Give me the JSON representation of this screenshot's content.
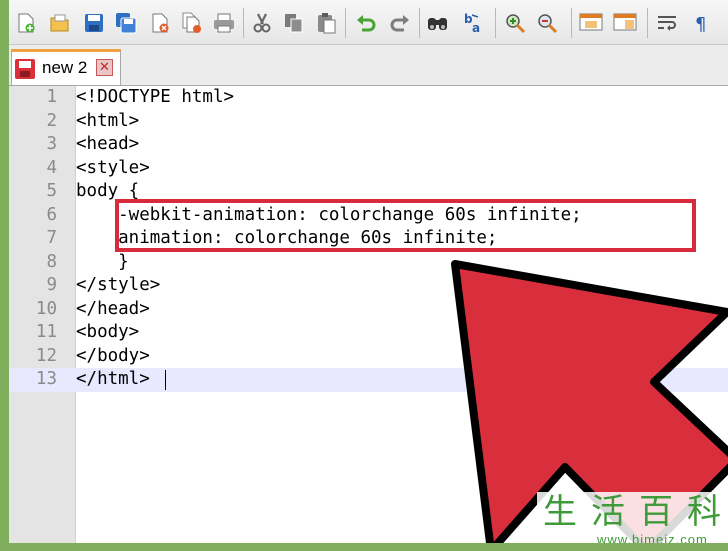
{
  "tabs": [
    {
      "label": "new 2",
      "close_symbol": "✕"
    }
  ],
  "toolbar": {
    "buttons": [
      "new-file-icon",
      "open-file-icon",
      "save-icon",
      "save-all-icon",
      "close-icon",
      "close-all-icon",
      "print-icon",
      "cut-icon",
      "copy-icon",
      "paste-icon",
      "undo-icon",
      "redo-icon",
      "find-icon",
      "replace-icon",
      "zoom-in-icon",
      "zoom-out-icon",
      "sync-vertical-icon",
      "sync-horizontal-icon",
      "word-wrap-icon",
      "show-all-characters-icon"
    ]
  },
  "editor": {
    "lines": [
      {
        "n": "1",
        "text": "<!DOCTYPE html>"
      },
      {
        "n": "2",
        "text": "<html>"
      },
      {
        "n": "3",
        "text": "<head>"
      },
      {
        "n": "4",
        "text": "<style>"
      },
      {
        "n": "5",
        "text": "body {"
      },
      {
        "n": "6",
        "text": "    -webkit-animation: colorchange 60s infinite;"
      },
      {
        "n": "7",
        "text": "    animation: colorchange 60s infinite;"
      },
      {
        "n": "8",
        "text": "    }"
      },
      {
        "n": "9",
        "text": "</style>"
      },
      {
        "n": "10",
        "text": "</head>"
      },
      {
        "n": "11",
        "text": "<body>"
      },
      {
        "n": "12",
        "text": "</body>"
      },
      {
        "n": "13",
        "text": "</html>"
      }
    ],
    "current_line": 13
  },
  "colors": {
    "frame": "#7fae5c",
    "highlight": "#d72a3a",
    "arrow": "#d92f3d",
    "current_line": "#e8e8ff"
  },
  "watermark": {
    "chars": "生活百科",
    "url": "www.bimeiz.com"
  }
}
